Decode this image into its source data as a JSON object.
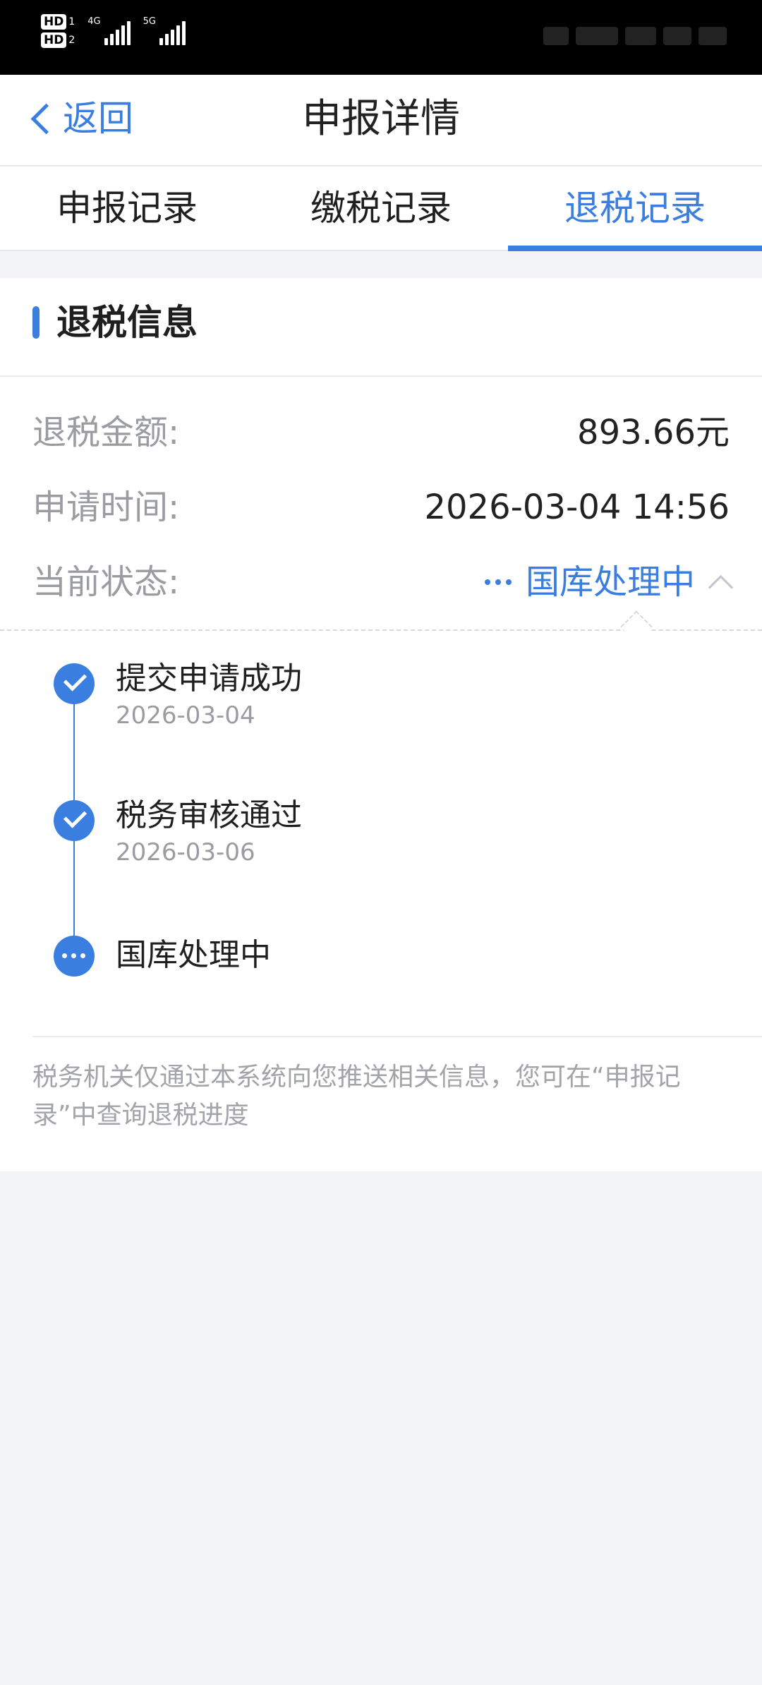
{
  "status_bar": {
    "sim1": "HD",
    "sim1_num": "1",
    "sim2": "HD",
    "sim2_num": "2",
    "net1": "4G",
    "net2": "5G"
  },
  "nav": {
    "back_label": "返回",
    "title": "申报详情"
  },
  "tabs": [
    {
      "label": "申报记录",
      "active": false
    },
    {
      "label": "缴税记录",
      "active": false
    },
    {
      "label": "退税记录",
      "active": true
    }
  ],
  "section": {
    "title": "退税信息"
  },
  "info": {
    "amount_key": "退税金额:",
    "amount_value": "893.66元",
    "time_key": "申请时间:",
    "time_value": "2026-03-04 14:56",
    "status_key": "当前状态:",
    "status_value": "国库处理中"
  },
  "timeline": [
    {
      "title": "提交申请成功",
      "date": "2026-03-04",
      "state": "done"
    },
    {
      "title": "税务审核通过",
      "date": "2026-03-06",
      "state": "done"
    },
    {
      "title": "国库处理中",
      "date": "",
      "state": "in-progress"
    }
  ],
  "note": "税务机关仅通过本系统向您推送相关信息，您可在“申报记录”中查询退税进度",
  "colors": {
    "accent": "#3a7fe0",
    "background": "#f3f4f8",
    "muted_text": "#9a9ca2"
  }
}
